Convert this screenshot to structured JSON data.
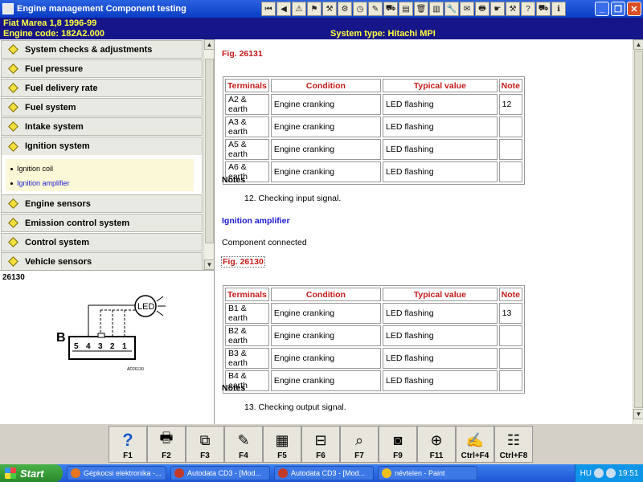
{
  "window": {
    "title": "Engine management Component testing",
    "toolbar_icons": [
      "first-icon",
      "prev-icon",
      "warning-icon",
      "flag-icon",
      "tool-icon",
      "tool2-icon",
      "clock-icon",
      "edit-icon",
      "car-icon",
      "book-icon",
      "trash-icon",
      "data-icon",
      "wrench-icon",
      "notes-icon",
      "print-icon",
      "pointer-icon",
      "tool3-icon",
      "help-icon",
      "car2-icon",
      "info-icon"
    ]
  },
  "info": {
    "vehicle": "Fiat   Marea  1,8  1996-99",
    "engine_code": "Engine code: 182A2.000",
    "system_type": "System type: Hitachi MPI"
  },
  "nav": {
    "items": [
      {
        "label": "System checks & adjustments"
      },
      {
        "label": "Fuel pressure"
      },
      {
        "label": "Fuel delivery rate"
      },
      {
        "label": "Fuel system"
      },
      {
        "label": "Intake system"
      },
      {
        "label": "Ignition system"
      },
      {
        "label": "Engine sensors"
      },
      {
        "label": "Emission control system"
      },
      {
        "label": "Control system"
      },
      {
        "label": "Vehicle sensors"
      }
    ],
    "sub_items": [
      {
        "label": "Ignition coil"
      },
      {
        "label": "Ignition amplifier"
      }
    ]
  },
  "figure": {
    "caption": "26130",
    "connector_letter": "B",
    "pins": [
      "5",
      "4",
      "3",
      "2",
      "1"
    ],
    "led_label": "LED",
    "ref_code": "AD26130"
  },
  "main": {
    "fig1": "Fig. 26131",
    "table_headers": [
      "Terminals",
      "Condition",
      "Typical value",
      "Note"
    ],
    "table1": [
      [
        "A2 & earth",
        "Engine cranking",
        "LED flashing",
        "12"
      ],
      [
        "A3 & earth",
        "Engine cranking",
        "LED flashing",
        ""
      ],
      [
        "A5 & earth",
        "Engine cranking",
        "LED flashing",
        ""
      ],
      [
        "A6 & earth",
        "Engine cranking",
        "LED flashing",
        ""
      ]
    ],
    "notes1_title": "Notes",
    "note12": "12. Checking input signal.",
    "section2": "Ignition amplifier",
    "component_text": "Component connected",
    "fig2": "Fig. 26130",
    "table2": [
      [
        "B1 & earth",
        "Engine cranking",
        "LED flashing",
        "13"
      ],
      [
        "B2 & earth",
        "Engine cranking",
        "LED flashing",
        ""
      ],
      [
        "B3 & earth",
        "Engine cranking",
        "LED flashing",
        ""
      ],
      [
        "B4 & earth",
        "Engine cranking",
        "LED flashing",
        ""
      ]
    ],
    "notes2_title": "Notes",
    "note13": "13. Checking output signal."
  },
  "fkeys": [
    {
      "label": "F1",
      "icon": "help-icon"
    },
    {
      "label": "F2",
      "icon": "print-icon"
    },
    {
      "label": "F3",
      "icon": "copy-icon"
    },
    {
      "label": "F4",
      "icon": "edit-icon"
    },
    {
      "label": "F5",
      "icon": "diagram-icon"
    },
    {
      "label": "F6",
      "icon": "connector-icon"
    },
    {
      "label": "F7",
      "icon": "zoom-icon"
    },
    {
      "label": "F9",
      "icon": "component-icon"
    },
    {
      "label": "F11",
      "icon": "locate-icon"
    },
    {
      "label": "Ctrl+F4",
      "icon": "note-icon"
    },
    {
      "label": "Ctrl+F8",
      "icon": "table-icon"
    }
  ],
  "taskbar": {
    "start": "Start",
    "tasks": [
      {
        "label": "Gépkocsi elektronika -...",
        "color": "#e8761e"
      },
      {
        "label": "Autodata CD3 - [Mod...",
        "color": "#c23b2a"
      },
      {
        "label": "Autodata CD3 - [Mod...",
        "color": "#c23b2a"
      },
      {
        "label": "névtelen - Paint",
        "color": "#f0c020"
      }
    ],
    "lang": "HU",
    "time": "19:51"
  }
}
